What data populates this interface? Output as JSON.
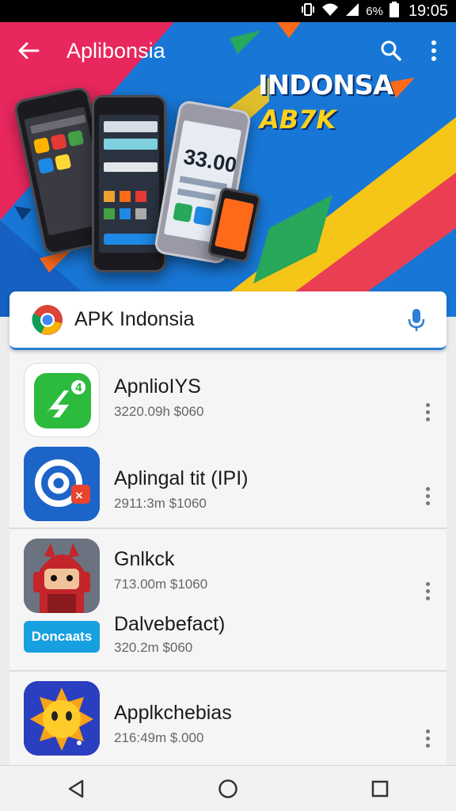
{
  "status_bar": {
    "battery_text": "6%",
    "time": "19:05",
    "icons": [
      "vibrate-icon",
      "wifi-icon",
      "signal-icon",
      "battery-icon"
    ]
  },
  "app_bar": {
    "title": "Aplibonsia",
    "icons": [
      "back-arrow-icon",
      "search-icon",
      "overflow-menu-icon"
    ]
  },
  "hero": {
    "headline": "INDONSA",
    "subline": "AB7K",
    "phone_number": "33.00",
    "colors": {
      "blue": "#1877d6",
      "pink": "#e8275d",
      "yellow": "#f5c518",
      "green": "#27a85a",
      "orange": "#ff6a1a"
    }
  },
  "search": {
    "value": "APK Indonsia",
    "logo": "chrome-logo",
    "mic": "mic-icon"
  },
  "apps": [
    {
      "name": "ApnlioIYS",
      "meta": "3220.09h  $060",
      "icon": "green-app-icon"
    },
    {
      "name": "Aplingal tit (IPI)",
      "meta": "2911:3m  $1060",
      "icon": "blue-at-app-icon"
    },
    {
      "name": "Gnlkck",
      "meta": "713.00m  $1060",
      "icon": "red-ninja-app-icon"
    },
    {
      "name": "Dalvebefact)",
      "meta": "320.2m  $060",
      "icon": "blue-badge-app-icon",
      "badge_text": "Doncaats"
    },
    {
      "name": "Applkchebias",
      "meta": "216:49m  $.000",
      "icon": "yellow-sun-app-icon"
    }
  ],
  "nav": {
    "icons": [
      "back-triangle-icon",
      "home-circle-icon",
      "recents-square-icon"
    ]
  }
}
